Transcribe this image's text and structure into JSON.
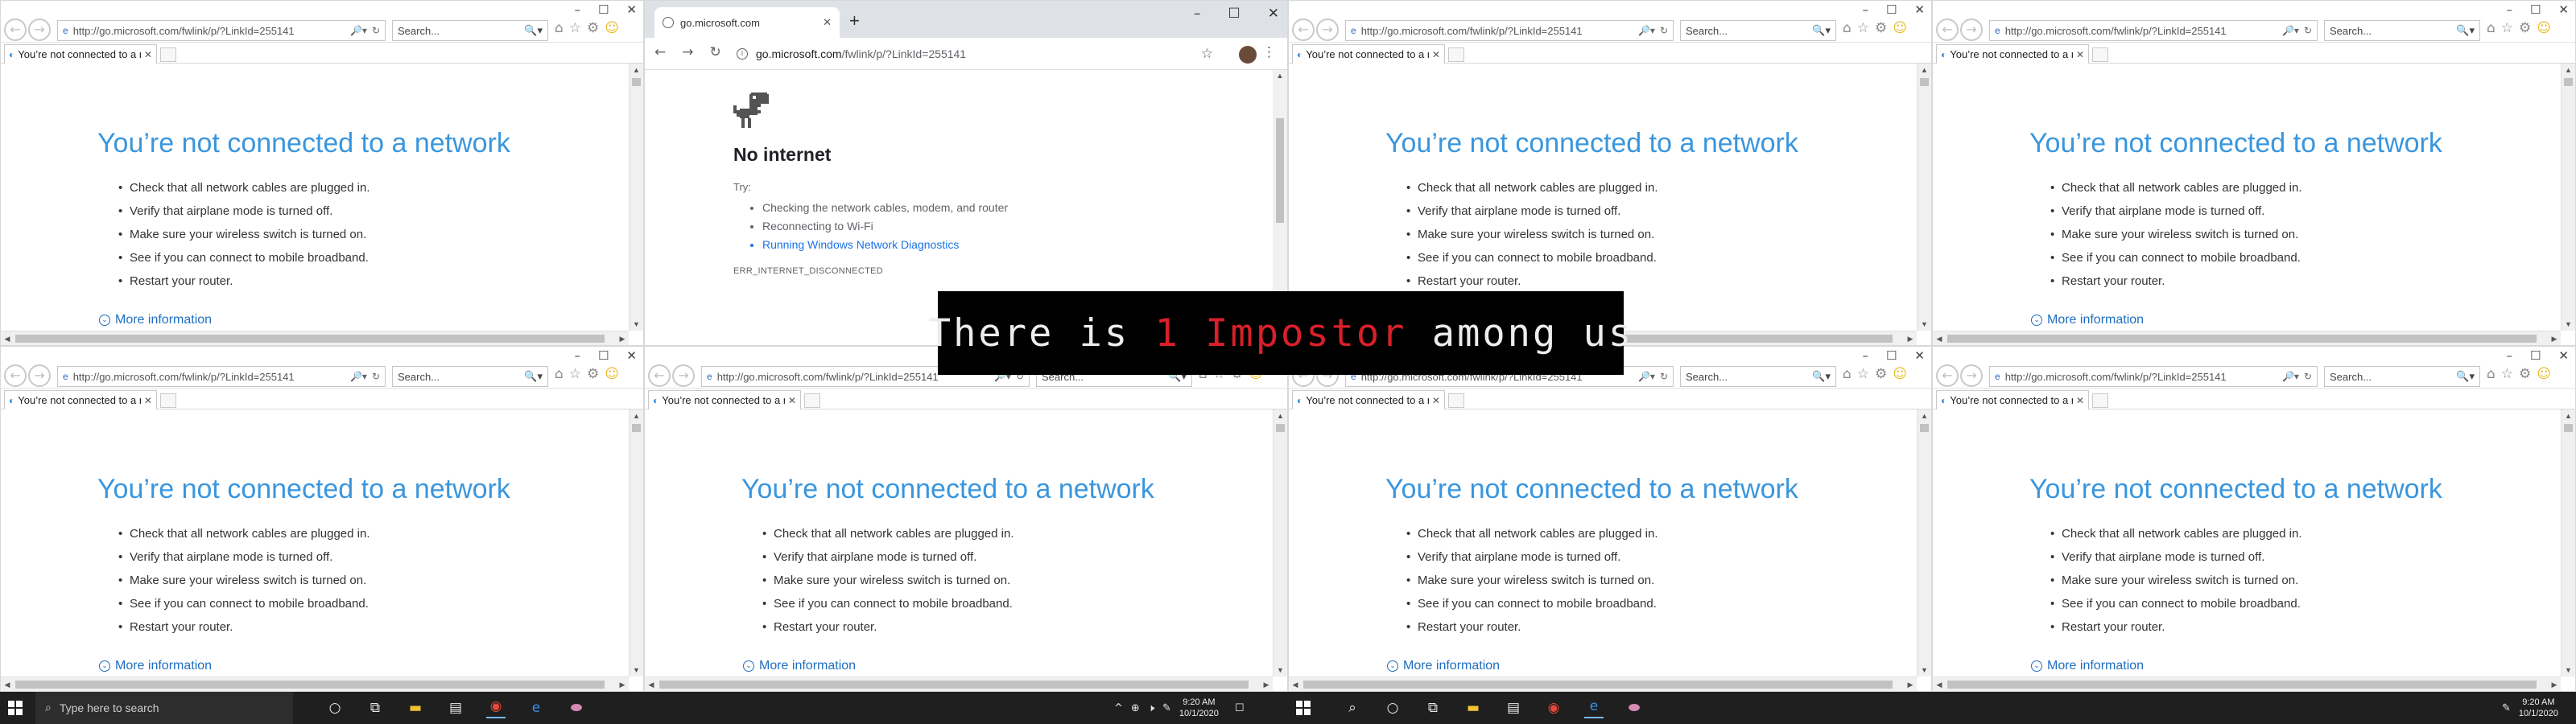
{
  "ie": {
    "address": "http://go.microsoft.com/fwlink/p/?LinkId=255141",
    "search_placeholder": "Search...",
    "tab_title": "You’re not connected to a n...",
    "heading": "You’re not connected to a network",
    "items": [
      "Check that all network cables are plugged in.",
      "Verify that airplane mode is turned off.",
      "Make sure your wireless switch is turned on.",
      "See if you can connect to mobile broadband.",
      "Restart your router."
    ],
    "more_info": "More information"
  },
  "chrome": {
    "tab_title": "go.microsoft.com",
    "url_host": "go.microsoft.com",
    "url_path": "/fwlink/p/?LinkId=255141",
    "heading": "No internet",
    "try_label": "Try:",
    "suggestions": [
      "Checking the network cables, modem, and router",
      "Reconnecting to Wi-Fi",
      "Running Windows Network Diagnostics"
    ],
    "error_code": "ERR_INTERNET_DISCONNECTED"
  },
  "banner": {
    "before": "There is ",
    "highlight": "1 Impostor",
    "after": " among us",
    "highlight_color": "#d8202a"
  },
  "taskbar": {
    "search_placeholder": "Type here to search",
    "time": "9:20 AM",
    "date": "10/1/2020"
  },
  "colors": {
    "ie_heading": "#3a96dd",
    "link": "#1f6fbf",
    "chrome_link": "#1a73e8",
    "taskbar": "#1f1f1f"
  }
}
